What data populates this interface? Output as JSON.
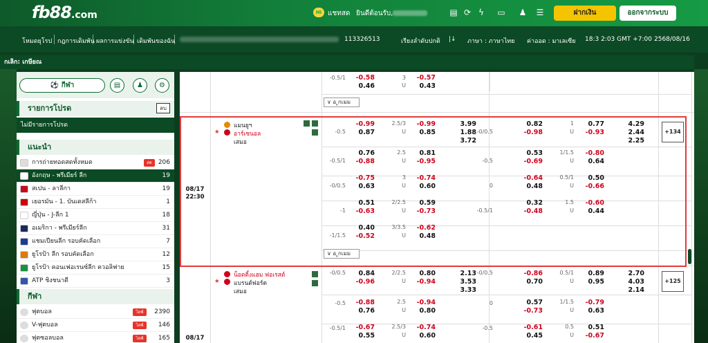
{
  "header": {
    "logo": "fb88",
    "logo_suffix": ".com",
    "chat_badge": "Hi",
    "chat_label": "แชทสด",
    "welcome": "ยินดีต้อนรับ,",
    "deposit": "ฝากเงิน",
    "logout": "ออกจากระบบ"
  },
  "nav": {
    "links": [
      "โหมดยุโรป",
      "กฎการเดิมพัน",
      "ผลการแข่งขัน",
      "เดิมพันของฉัน"
    ],
    "account_id": "113326513",
    "sort": "เรียงลำดับปกติ",
    "odds_type_symbol": "|↓",
    "language": "ภาษา : ภาษาไทย",
    "odds_format": "ค่าออด : มาเลเซีย",
    "time": "18:3 2:03 GMT +7:00",
    "date": "2568/08/16"
  },
  "breadcrumb": "กเลิก: เกษียณ",
  "sidebar": {
    "sport_pill": "กีฬา",
    "promo_title": "รายการโปรด",
    "promo_btn": "ลบ",
    "no_favorites": "ไม่มีรายการโปรด",
    "recommend_title": "แนะนำ",
    "recommend": [
      {
        "label": "การถ่ายทอดสดทั้งหมด",
        "count": "206",
        "live": "สด",
        "color": "#dddddd"
      },
      {
        "label": "อังกฤษ - พรีเมียร์ ลีก",
        "count": "19",
        "selected": true,
        "color": "#ffffff"
      },
      {
        "label": "สเปน - ลาลีกา",
        "count": "19",
        "color": "#c60b1e"
      },
      {
        "label": "เยอรมัน - 1. บันเดสลีก้า",
        "count": "1",
        "color": "#d00000"
      },
      {
        "label": "ญี่ปุ่น - J-ลีก 1",
        "count": "18",
        "color": "#ffffff"
      },
      {
        "label": "อเมริกา - พรีเมียร์ลีก",
        "count": "31",
        "color": "#1b2a5c"
      },
      {
        "label": "แชมเปียนลีก รอบคัดเลือก",
        "count": "7",
        "color": "#1a3d8f"
      },
      {
        "label": "ยูโรป้า ลีก รอบคัดเลือก",
        "count": "12",
        "color": "#e07a00"
      },
      {
        "label": "ยูโรป้า คอนเฟอเรนซ์ลีก ควอลิฟาย",
        "count": "15",
        "color": "#1a8f3d"
      },
      {
        "label": "ATP ชิงชนาดี",
        "count": "3",
        "color": "#3355aa"
      }
    ],
    "sport_title": "กีฬา",
    "sports": [
      {
        "label": "ฟุตบอล",
        "live": "ไลฟ์",
        "count": "2390"
      },
      {
        "label": "V-ฟุตบอล",
        "live": "ไลฟ์",
        "count": "146"
      },
      {
        "label": "ฟุตซอลบอล",
        "live": "ไลฟ์",
        "count": "165"
      }
    ]
  },
  "odds": {
    "more_label": "อ ูกเมม",
    "top_block": {
      "hcp1": "-0.5/1",
      "o1": "-0.58",
      "o2": "0.46",
      "hcp2": "3",
      "u": "U",
      "o3": "-0.57",
      "o4": "0.43"
    },
    "match1": {
      "date": "08/17",
      "time": "22:30",
      "home": "แมนยูฯ",
      "away": "อาร์เซนอล",
      "draw": "เสมอ",
      "plus": "+134",
      "rows": [
        {
          "h": "-0.5",
          "a": "-0.99",
          "b": "0.87",
          "g": "2.5/3",
          "u": "U",
          "c": "-0.99",
          "d": "0.85",
          "x1": "3.99",
          "x2": "1.88",
          "x3": "3.72",
          "h2": "-0/0.5",
          "e": "0.82",
          "f": "-0.98",
          "g2": "1",
          "i": "0.77",
          "j": "-0.93",
          "y1": "4.29",
          "y2": "2.44",
          "y3": "2.25"
        },
        {
          "h": "-0.5/1",
          "a": "0.76",
          "b": "-0.88",
          "g": "2.5",
          "u": "U",
          "c": "0.81",
          "d": "-0.95",
          "h2": "-0.5",
          "e": "0.53",
          "f": "-0.69",
          "g2": "1/1.5",
          "i": "-0.80",
          "j": "0.64"
        },
        {
          "h": "-0/0.5",
          "a": "-0.75",
          "b": "0.63",
          "g": "3",
          "u": "U",
          "c": "-0.74",
          "d": "0.60",
          "h2": "0",
          "e": "-0.64",
          "f": "0.48",
          "g2": "0.5/1",
          "i": "0.50",
          "j": "-0.66"
        },
        {
          "h": "-1",
          "a": "0.51",
          "b": "-0.63",
          "g": "2/2.5",
          "u": "U",
          "c": "0.59",
          "d": "-0.73",
          "h2": "-0.5/1",
          "e": "0.32",
          "f": "-0.48",
          "g2": "1.5",
          "i": "-0.60",
          "j": "0.44"
        },
        {
          "h": "-1/1.5",
          "a": "0.40",
          "b": "-0.52",
          "g": "3/3.5",
          "u": "U",
          "c": "-0.62",
          "d": "0.48"
        }
      ]
    },
    "match2": {
      "home": "น็อตติ้งแฮม ฟอเรสต์",
      "away": "แบรนต์ฟอร์ด",
      "draw": "เสมอ",
      "plus": "+125",
      "date": "08/17",
      "rows": [
        {
          "h": "-0/0.5",
          "a": "0.84",
          "b": "-0.96",
          "g": "2/2.5",
          "u": "U",
          "c": "0.80",
          "d": "-0.94",
          "x1": "2.13",
          "x2": "3.53",
          "x3": "3.33",
          "h2": "-0/0.5",
          "e": "-0.86",
          "f": "0.70",
          "g2": "0.5/1",
          "i": "0.89",
          "j": "0.95",
          "y1": "2.70",
          "y2": "4.03",
          "y3": "2.14"
        },
        {
          "h": "-0.5",
          "a": "-0.88",
          "b": "0.76",
          "g": "2.5",
          "u": "U",
          "c": "-0.94",
          "d": "0.80",
          "h2": "0",
          "e": "0.57",
          "f": "-0.73",
          "g2": "1/1.5",
          "i": "-0.79",
          "j": "0.63"
        },
        {
          "h": "-0.5/1",
          "a": "-0.67",
          "b": "0.55",
          "g": "2.5/3",
          "u": "U",
          "c": "-0.74",
          "d": "0.60",
          "h2": "-0.5",
          "e": "-0.61",
          "f": "0.45",
          "g2": "0.5",
          "i": "0.51",
          "j": "-0.67"
        }
      ]
    }
  }
}
